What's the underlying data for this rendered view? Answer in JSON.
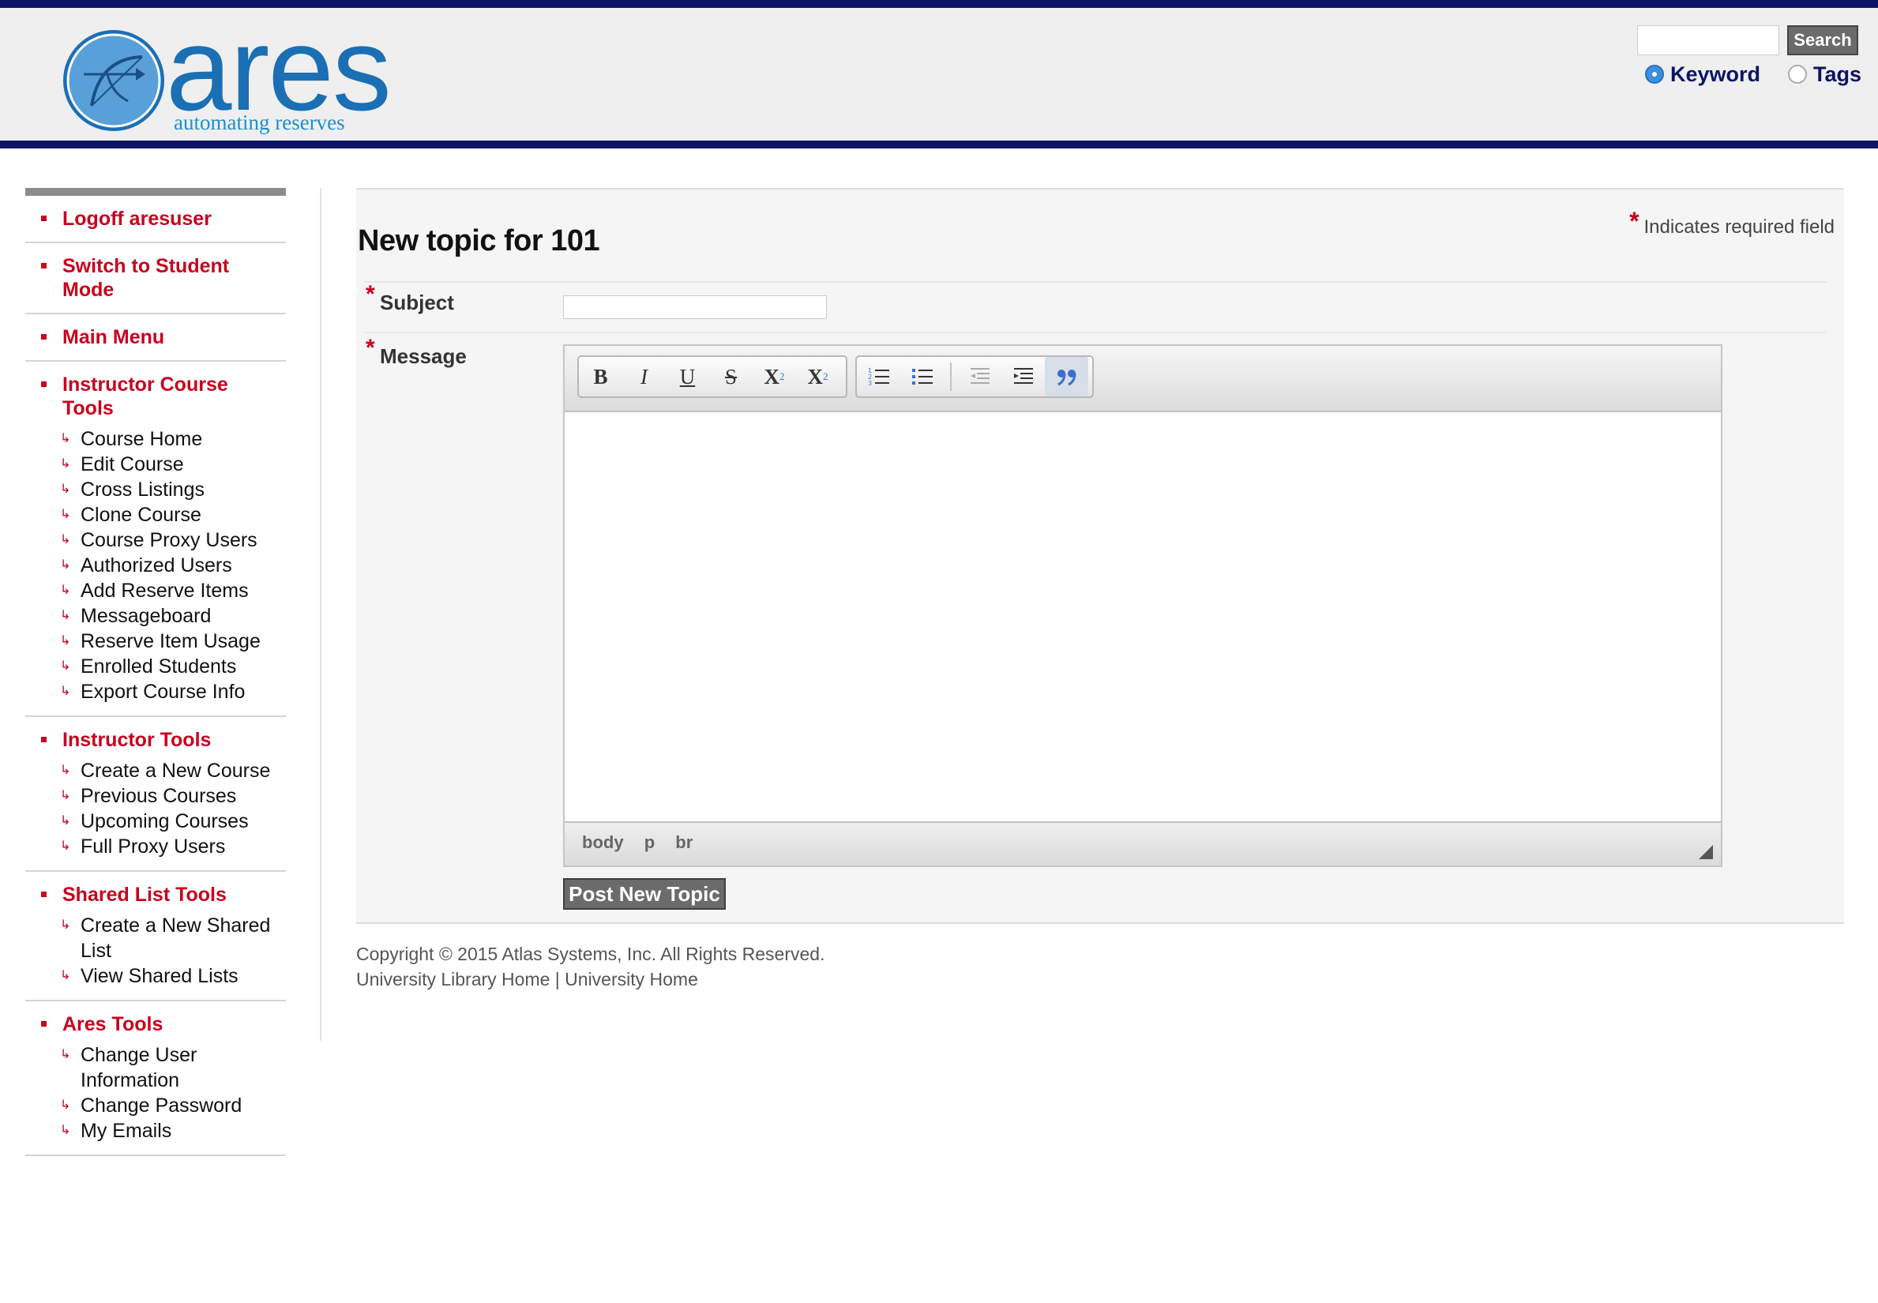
{
  "header": {
    "logo_word": "ares",
    "logo_tagline": "automating reserves",
    "search": {
      "value": "",
      "button_label": "Search"
    },
    "search_mode": {
      "options": [
        "Keyword",
        "Tags"
      ],
      "selected": "Keyword"
    }
  },
  "sidebar": {
    "blocks": [
      {
        "head": "Logoff aresuser",
        "items": []
      },
      {
        "head": "Switch to Student Mode",
        "items": []
      },
      {
        "head": "Main Menu",
        "items": []
      },
      {
        "head": "Instructor Course Tools",
        "items": [
          "Course Home",
          "Edit Course",
          "Cross Listings",
          "Clone Course",
          "Course Proxy Users",
          "Authorized Users",
          "Add Reserve Items",
          "Messageboard",
          "Reserve Item Usage",
          "Enrolled Students",
          "Export Course Info"
        ]
      },
      {
        "head": "Instructor Tools",
        "items": [
          "Create a New Course",
          "Previous Courses",
          "Upcoming Courses",
          "Full Proxy Users"
        ]
      },
      {
        "head": "Shared List Tools",
        "items": [
          "Create a New Shared List",
          "View Shared Lists"
        ]
      },
      {
        "head": "Ares Tools",
        "items": [
          "Change User Information",
          "Change Password",
          "My Emails"
        ]
      }
    ]
  },
  "main": {
    "required_note": "Indicates required field",
    "required_star": "*",
    "title": "New topic for 101",
    "subject_label": "Subject",
    "subject_value": "",
    "message_label": "Message",
    "toolbar": {
      "group1": [
        {
          "icon": "bold-icon",
          "glyph": "B"
        },
        {
          "icon": "italic-icon",
          "glyph": "I"
        },
        {
          "icon": "underline-icon",
          "glyph": "U"
        },
        {
          "icon": "strikethrough-icon",
          "glyph": "S"
        },
        {
          "icon": "subscript-icon",
          "glyph": "X"
        },
        {
          "icon": "superscript-icon",
          "glyph": "X"
        }
      ],
      "group2": [
        {
          "icon": "numbered-list-icon"
        },
        {
          "icon": "bulleted-list-icon"
        },
        {
          "icon": "outdent-icon"
        },
        {
          "icon": "indent-icon"
        },
        {
          "icon": "blockquote-icon"
        }
      ]
    },
    "element_path": [
      "body",
      "p",
      "br"
    ],
    "submit_label": "Post New Topic"
  },
  "footer": {
    "copyright": "Copyright © 2015 Atlas Systems, Inc. All Rights Reserved.",
    "links": [
      "University Library Home",
      "University Home"
    ],
    "separator": "|"
  },
  "colors": {
    "header_bar": "#0c1466",
    "nav_red": "#c8001e",
    "logo_blue": "#1b6fb5",
    "button_gray": "#6b6b6b"
  }
}
